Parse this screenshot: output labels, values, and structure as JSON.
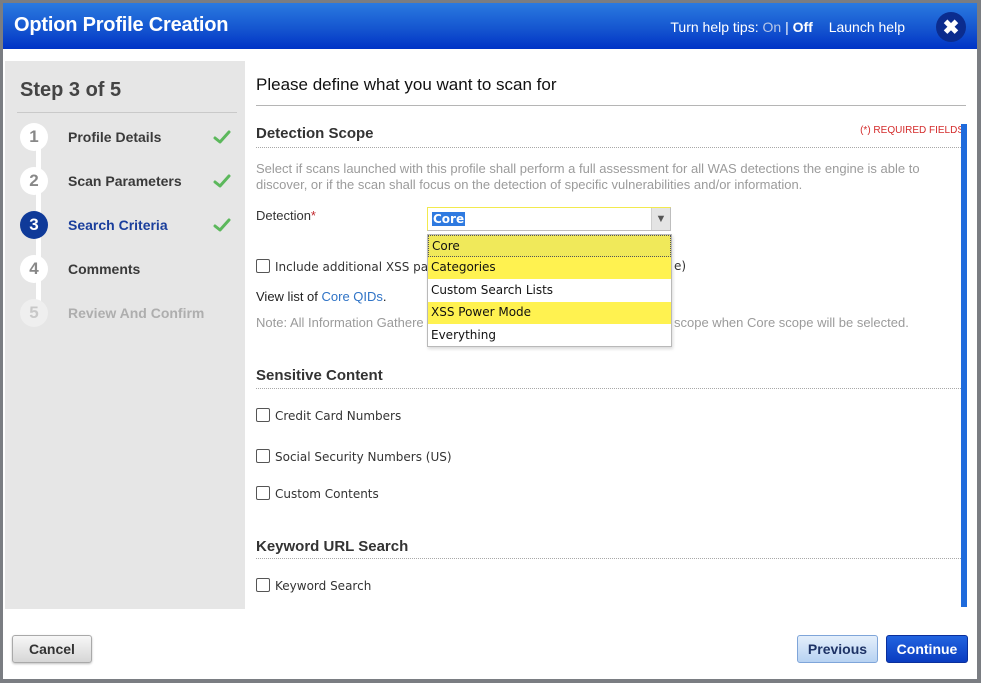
{
  "header": {
    "title": "Option Profile Creation",
    "help_prefix": "Turn help tips:",
    "help_on": "On",
    "help_sep": "|",
    "help_off": "Off",
    "launch_help": "Launch help",
    "close_glyph": "✖"
  },
  "sidebar": {
    "step_title": "Step 3 of 5",
    "steps": [
      {
        "num": "1",
        "label": "Profile Details",
        "done": true
      },
      {
        "num": "2",
        "label": "Scan Parameters",
        "done": true
      },
      {
        "num": "3",
        "label": "Search Criteria",
        "done": true,
        "active": true
      },
      {
        "num": "4",
        "label": "Comments",
        "done": false
      },
      {
        "num": "5",
        "label": "Review And Confirm",
        "done": false,
        "disabled": true
      }
    ]
  },
  "main": {
    "heading": "Please define what you want to scan for",
    "required_note": "(*) REQUIRED FIELDS",
    "detection_scope": {
      "title": "Detection Scope",
      "description": "Select if scans launched with this profile shall perform a full assessment for all WAS detections the engine is able to discover, or if the scan shall focus on the detection of specific vulnerabilities and/or information.",
      "field_label": "Detection",
      "required_marker": "*",
      "selected": "Core",
      "arrow_glyph": "⌄",
      "options": [
        "Core",
        "Categories",
        "Custom Search Lists",
        "XSS Power Mode",
        "Everything"
      ],
      "xss_checkbox_label_left": "Include additional XSS pay",
      "xss_checkbox_label_right": "e)",
      "link_prefix": "View list of ",
      "link_text": "Core QIDs",
      "link_suffix": ".",
      "note_left": "Note: All Information Gathere",
      "note_right": "scope when Core scope will be selected."
    },
    "sensitive_content": {
      "title": "Sensitive Content",
      "items": [
        "Credit Card Numbers",
        "Social Security Numbers (US)",
        "Custom Contents"
      ]
    },
    "keyword_url_search": {
      "title": "Keyword URL Search",
      "items": [
        "Keyword Search"
      ]
    }
  },
  "footer": {
    "cancel": "Cancel",
    "previous": "Previous",
    "continue": "Continue"
  },
  "colors": {
    "header_blue": "#1556d0",
    "active_step": "#0f3a99",
    "check_green": "#5cb85c",
    "required_red": "#d42b2b",
    "highlight_yellow": "#fff250",
    "link_blue": "#2f73c6"
  }
}
